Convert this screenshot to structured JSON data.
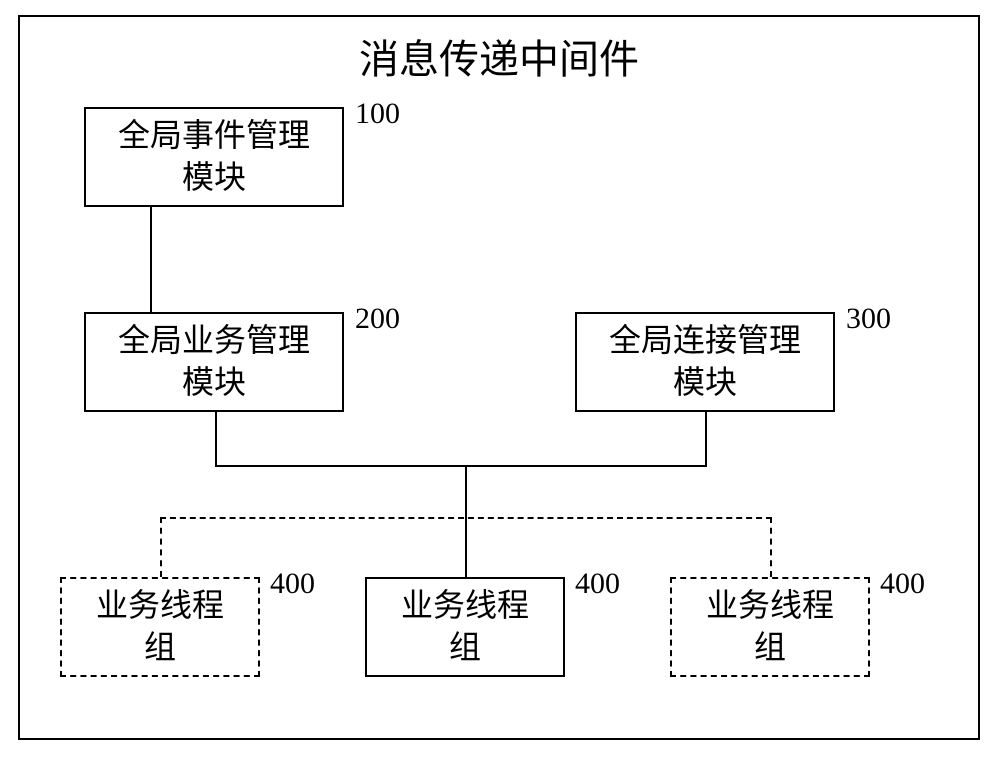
{
  "title": "消息传递中间件",
  "boxes": {
    "event_mgmt": {
      "text": "全局事件管理\n模块",
      "label": "100"
    },
    "biz_mgmt": {
      "text": "全局业务管理\n模块",
      "label": "200"
    },
    "conn_mgmt": {
      "text": "全局连接管理\n模块",
      "label": "300"
    },
    "thread_group_1": {
      "text": "业务线程\n组",
      "label": "400"
    },
    "thread_group_2": {
      "text": "业务线程\n组",
      "label": "400"
    },
    "thread_group_3": {
      "text": "业务线程\n组",
      "label": "400"
    }
  }
}
